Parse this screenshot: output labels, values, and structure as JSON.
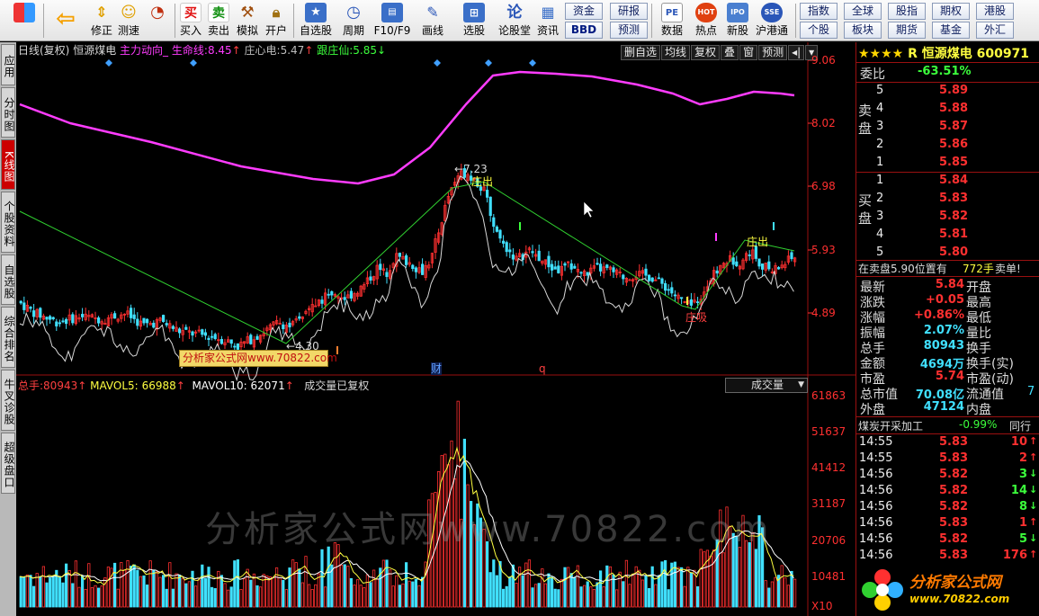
{
  "toolbar": {
    "buttons": [
      {
        "label": "",
        "icon": "menu-grid-icon"
      },
      {
        "label": "",
        "icon": "back-arrow-icon"
      },
      {
        "label": "修正",
        "icon": "up-down-arrows-icon"
      },
      {
        "label": "测速",
        "icon": "smile-icon"
      },
      {
        "label": "",
        "icon": "clock-icon"
      },
      {
        "label": "买入",
        "icon": "buy-icon",
        "glyph": "买"
      },
      {
        "label": "卖出",
        "icon": "sell-icon",
        "glyph": "卖"
      },
      {
        "label": "模拟",
        "icon": "gavel-icon"
      },
      {
        "label": "开户",
        "icon": "lock-icon"
      },
      {
        "label": "自选股",
        "icon": "star-folder-icon"
      },
      {
        "label": "周期",
        "icon": "period-clock-icon"
      },
      {
        "label": "F10/F9",
        "icon": "f10-icon"
      },
      {
        "label": "画线",
        "icon": "pen-icon"
      },
      {
        "label": "选股",
        "icon": "pick-stock-icon"
      },
      {
        "label": "论股堂",
        "icon": "forum-icon",
        "glyph": "论"
      },
      {
        "label": "资讯",
        "icon": "news-icon"
      },
      {
        "label": "数据",
        "icon": "pe-data-icon",
        "glyph": "PE"
      },
      {
        "label": "热点",
        "icon": "hot-icon",
        "glyph": "HOT"
      },
      {
        "label": "新股",
        "icon": "new-stock-icon",
        "glyph": "IPO"
      },
      {
        "label": "沪港通",
        "icon": "sse-hkex-icon",
        "glyph": "SSE"
      }
    ],
    "group1": [
      "资金",
      "研报",
      "BBD",
      "预测"
    ],
    "group2": [
      "指数",
      "全球",
      "股指",
      "期权",
      "港股",
      "个股",
      "板块",
      "期货",
      "基金",
      "外汇"
    ]
  },
  "left_tabs": [
    "应用",
    "分时图",
    "K线图",
    "个股资料",
    "自选股",
    "综合排名",
    "牛叉诊股",
    "超级盘口"
  ],
  "chart_header": {
    "period": "日线(复权)",
    "stock": "恒源煤电",
    "indicator": "主力动向_",
    "lifeline_label": "生命线:",
    "lifeline_value": "8.45",
    "zxd_label": "庄心电:",
    "zxd_value": "5.47",
    "gzx_label": "跟庄仙:",
    "gzx_value": "5.85"
  },
  "chart_tools": [
    "删自选",
    "均线",
    "复权",
    "叠",
    "窗",
    "预测"
  ],
  "price_axis": [
    "9.06",
    "8.02",
    "6.98",
    "5.93",
    "4.89"
  ],
  "annotations": {
    "high": "7.23",
    "low": "4.30",
    "out1": "庄出",
    "out2": "庄出",
    "absorb": "庄吸",
    "cai": "财",
    "q": "q",
    "ad": "分析家公式网www.70822.com"
  },
  "volume_header": {
    "total_label": "总手:",
    "total_value": "80943",
    "ma5_label": "MAVOL5:",
    "ma5_value": "66988",
    "ma10_label": "MAVOL10:",
    "ma10_value": "62071",
    "note": "成交量已复权",
    "dropdown": "成交量"
  },
  "volume_axis": [
    "61863",
    "51637",
    "41412",
    "31187",
    "20706",
    "10481",
    "X10"
  ],
  "watermark": "分析家公式网www.70822.com",
  "colors": {
    "candle_up": "#ff3030",
    "candle_down": "#40e0ff",
    "lifeline": "#ff3cff",
    "trend": "#30d030",
    "zxd": "#d8d8d8"
  },
  "chart_data": {
    "type": "candlestick",
    "price_range": [
      4.3,
      9.06
    ],
    "volume_max": 61863,
    "lifeline_last": 8.45,
    "high": 7.23,
    "low": 4.3,
    "last_close": 5.84,
    "last_volume": 80943,
    "mavol5": 66988,
    "mavol10": 62071
  },
  "quote": {
    "stars": "★★★★",
    "name": "R 恒源煤电 600971",
    "weibi_label": "委比",
    "weibi_value": "-63.51%",
    "sell_label": "卖盘",
    "buy_label": "买盘",
    "asks": [
      {
        "level": "5",
        "price": "5.89"
      },
      {
        "level": "4",
        "price": "5.88"
      },
      {
        "level": "3",
        "price": "5.87"
      },
      {
        "level": "2",
        "price": "5.86"
      },
      {
        "level": "1",
        "price": "5.85"
      }
    ],
    "bids": [
      {
        "level": "1",
        "price": "5.84"
      },
      {
        "level": "2",
        "price": "5.83"
      },
      {
        "level": "3",
        "price": "5.82"
      },
      {
        "level": "4",
        "price": "5.81"
      },
      {
        "level": "5",
        "price": "5.80"
      }
    ],
    "notice_left": "在卖盘5.90位置有",
    "notice_vol": "772手",
    "notice_right": "卖单!",
    "stats": [
      {
        "l": "最新",
        "v": "5.84",
        "l2": "开盘"
      },
      {
        "l": "涨跌",
        "v": "+0.05",
        "l2": "最高"
      },
      {
        "l": "涨幅",
        "v": "+0.86%",
        "l2": "最低"
      },
      {
        "l": "振幅",
        "v": "2.07%",
        "l2": "量比"
      },
      {
        "l": "总手",
        "v": "80943",
        "l2": "换手"
      },
      {
        "l": "金额",
        "v": "4694万",
        "l2": "换手(实)"
      },
      {
        "l": "市盈",
        "v": "5.74",
        "l2": "市盈(动)"
      },
      {
        "l": "总市值",
        "v": "70.08亿",
        "l2": "流通值",
        "v2": "7"
      },
      {
        "l": "外盘",
        "v": "47124",
        "l2": "内盘"
      }
    ],
    "sector_name": "煤炭开采加工",
    "sector_change": "-0.99%",
    "sector_tab": "同行"
  },
  "ticks": [
    {
      "time": "14:55",
      "price": "5.83",
      "vol": "10",
      "dir": "up"
    },
    {
      "time": "14:55",
      "price": "5.83",
      "vol": "2",
      "dir": "up"
    },
    {
      "time": "14:56",
      "price": "5.82",
      "vol": "3",
      "dir": "down"
    },
    {
      "time": "14:56",
      "price": "5.82",
      "vol": "14",
      "dir": "down"
    },
    {
      "time": "14:56",
      "price": "5.82",
      "vol": "8",
      "dir": "down"
    },
    {
      "time": "14:56",
      "price": "5.83",
      "vol": "1",
      "dir": "up"
    },
    {
      "time": "14:56",
      "price": "5.82",
      "vol": "5",
      "dir": "down"
    },
    {
      "time": "14:56",
      "price": "5.83",
      "vol": "176",
      "dir": "up"
    }
  ],
  "logo": {
    "line1": "分析家公式网",
    "line2": "www.70822.com"
  }
}
